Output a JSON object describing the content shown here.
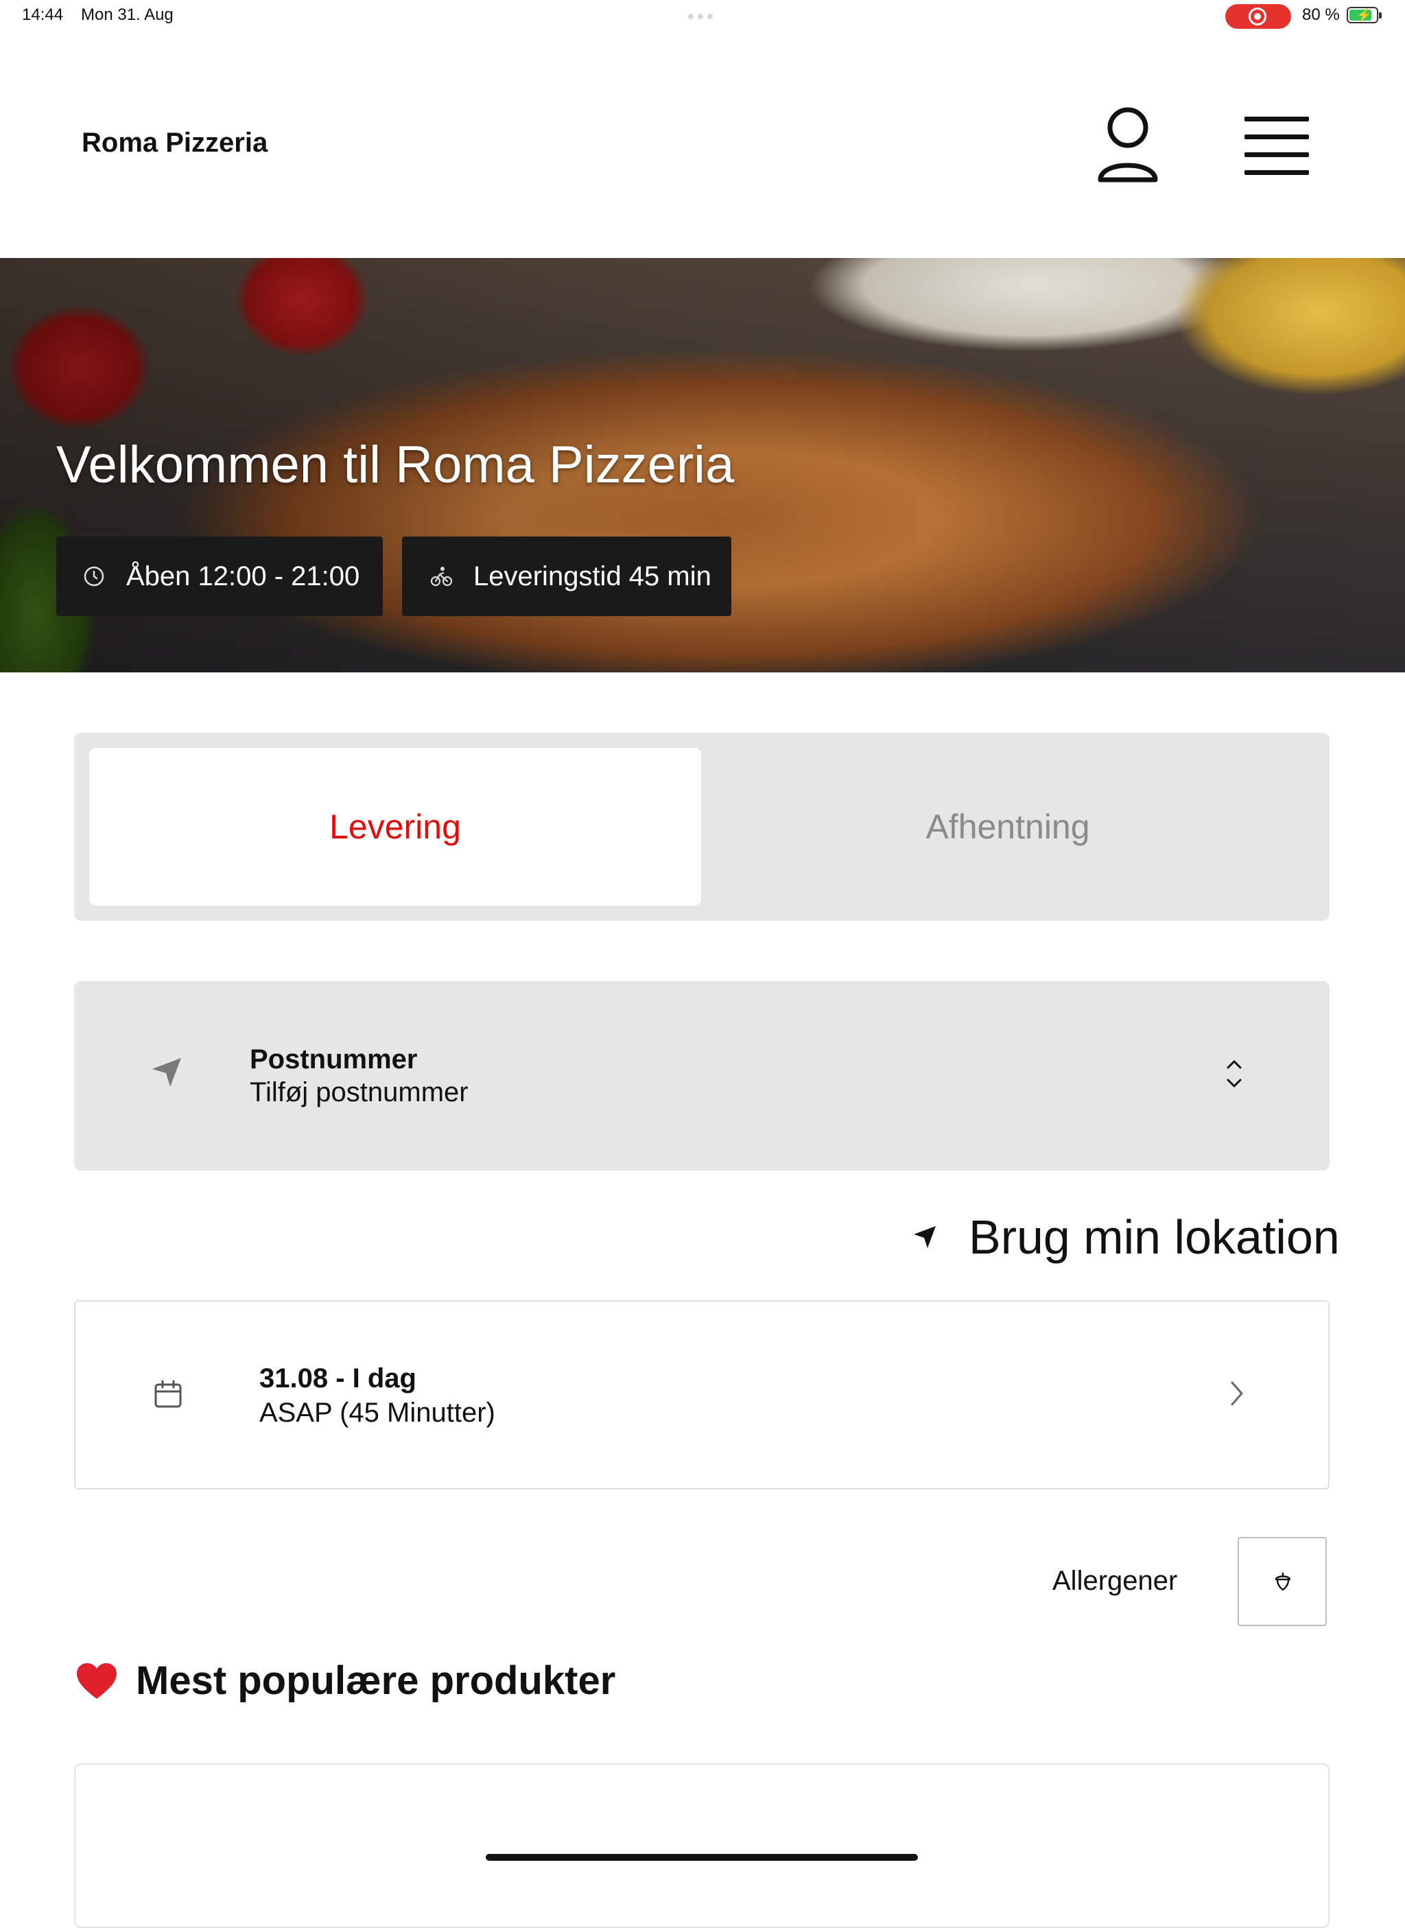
{
  "status_bar": {
    "time": "14:44",
    "date": "Mon 31. Aug",
    "battery_percent": "80 %",
    "battery_level": 0.8,
    "recording_color": "#e5322d",
    "battery_color": "#34c759"
  },
  "header": {
    "brand": "Roma Pizzeria",
    "user_icon": "user-icon",
    "menu_icon": "hamburger-menu-icon"
  },
  "hero": {
    "title": "Velkommen til Roma Pizzeria",
    "open_hours": "Åben 12:00 - 21:00",
    "delivery_time": "Leveringstid 45 min",
    "open_icon": "clock-icon",
    "delivery_icon": "bicycle-icon"
  },
  "order_mode": {
    "options": [
      "Levering",
      "Afhentning"
    ],
    "selected": "Levering",
    "accent_color": "#e00d0d"
  },
  "zip": {
    "label": "Postnummer",
    "value": "Tilføj postnummer",
    "icon": "location-arrow-icon"
  },
  "location_link": {
    "label": "Brug min lokation",
    "icon": "location-arrow-icon"
  },
  "schedule": {
    "date": "31.08 - I dag",
    "time": "ASAP (45 Minutter)",
    "icon": "calendar-icon"
  },
  "allergens": {
    "label": "Allergener",
    "icon": "acorn-icon"
  },
  "popular": {
    "emoji": "❤️",
    "title": "Mest populære produkter"
  }
}
